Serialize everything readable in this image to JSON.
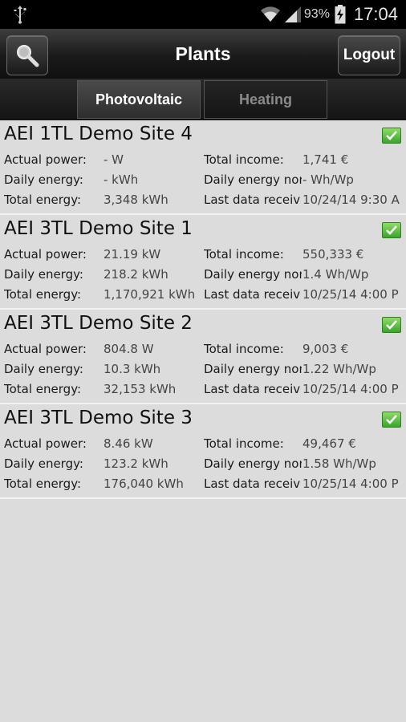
{
  "status_bar": {
    "battery_percent": "93%",
    "time": "17:04",
    "icons": [
      "usb-icon",
      "wifi-icon",
      "signal-icon",
      "battery-charging-icon"
    ]
  },
  "header": {
    "title": "Plants",
    "logout_label": "Logout",
    "search_icon": "search-icon"
  },
  "tabs": [
    {
      "label": "Photovoltaic",
      "active": true
    },
    {
      "label": "Heating",
      "active": false
    }
  ],
  "labels": {
    "actual_power": "Actual power:",
    "daily_energy": "Daily energy:",
    "total_energy": "Total energy:",
    "total_income": "Total income:",
    "daily_energy_norm": "Daily energy nor",
    "last_data": "Last data receiv"
  },
  "plants": [
    {
      "name": "AEI 1TL Demo Site 4",
      "actual_power": "- W",
      "daily_energy": "- kWh",
      "total_energy": "3,348 kWh",
      "total_income": "1,741 €",
      "daily_energy_norm": "- Wh/Wp",
      "last_data": "10/24/14 9:30 A",
      "status_icon": "checkbox-checked-icon"
    },
    {
      "name": "AEI 3TL Demo Site 1",
      "actual_power": "21.19 kW",
      "daily_energy": "218.2 kWh",
      "total_energy": "1,170,921 kWh",
      "total_income": "550,333 €",
      "daily_energy_norm": "1.4 Wh/Wp",
      "last_data": "10/25/14 4:00 P",
      "status_icon": "checkbox-checked-icon"
    },
    {
      "name": "AEI 3TL Demo Site 2",
      "actual_power": "804.8 W",
      "daily_energy": "10.3 kWh",
      "total_energy": "32,153 kWh",
      "total_income": "9,003 €",
      "daily_energy_norm": "1.22 Wh/Wp",
      "last_data": "10/25/14 4:00 P",
      "status_icon": "checkbox-checked-icon"
    },
    {
      "name": "AEI 3TL Demo Site 3",
      "actual_power": "8.46 kW",
      "daily_energy": "123.2 kWh",
      "total_energy": "176,040 kWh",
      "total_income": "49,467 €",
      "daily_energy_norm": "1.58 Wh/Wp",
      "last_data": "10/25/14 4:00 P",
      "status_icon": "checkbox-checked-icon"
    }
  ],
  "colors": {
    "background": "#dcdcdc",
    "header": "#1a1a1a",
    "status_ok": "#4cbb34"
  }
}
